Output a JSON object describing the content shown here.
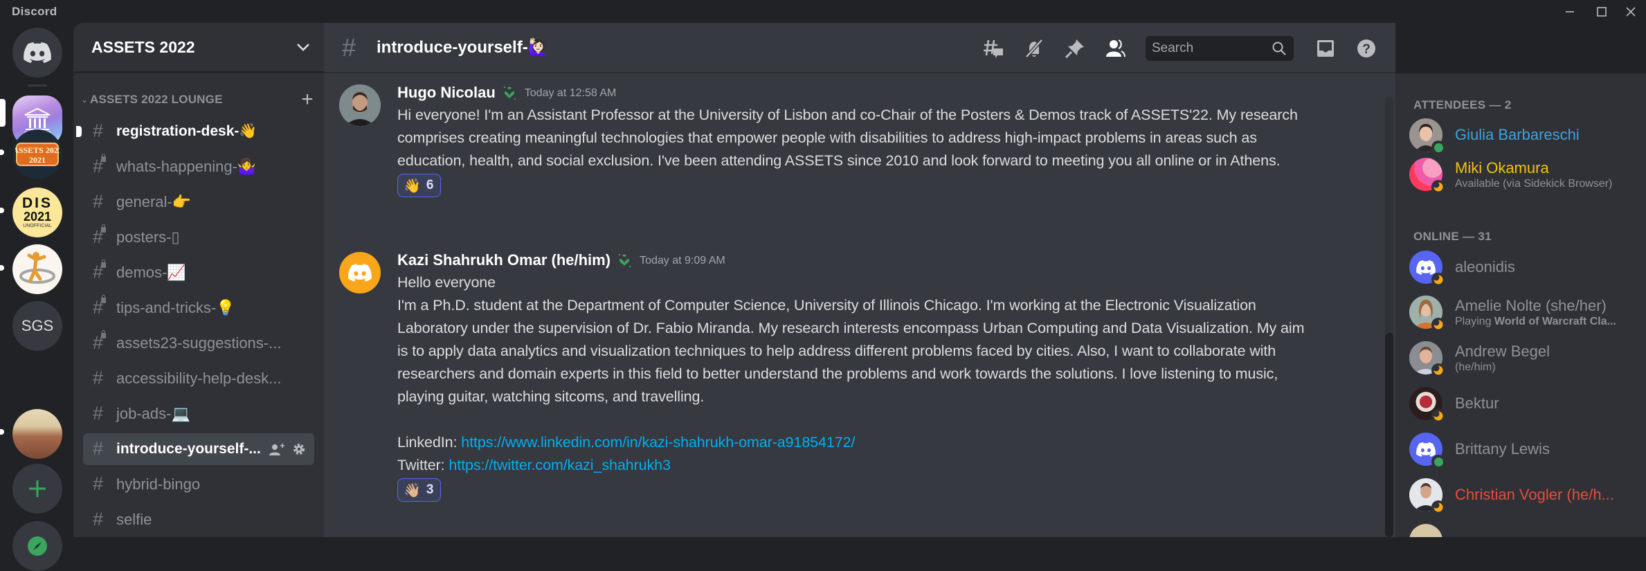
{
  "window": {
    "app_title": "Discord",
    "controls": [
      "minimize",
      "maximize",
      "close"
    ]
  },
  "server_rail": {
    "home_icon": "discord-logo-icon",
    "servers": [
      {
        "name": "ASSETS 2022",
        "icon": "assets-2022-server-icon",
        "active": true
      },
      {
        "name": "ASSETS 2021",
        "icon": "assets-2021-server-icon",
        "label": "ASSETS 2021",
        "unread": true
      },
      {
        "name": "DIS 2021 Unofficial",
        "icon": "dis-2021-server-icon",
        "label_top": "DIS",
        "label_mid": "2021",
        "label_bottom": "UNOFFICIAL",
        "unread": true
      },
      {
        "name": "Person logo server",
        "icon": "person-ring-server-icon",
        "unread": true
      },
      {
        "name": "SGS",
        "icon": "sgs-server-icon",
        "label": "SGS"
      },
      {
        "name": "Landscape server",
        "icon": "landscape-server-icon",
        "unread": true
      }
    ],
    "add_server_icon": "plus-icon",
    "explore_icon": "compass-icon"
  },
  "channel_sidebar": {
    "guild_name": "ASSETS 2022",
    "category": "ASSETS 2022 LOUNGE",
    "channels": [
      {
        "name": "registration-desk-👋",
        "locked": false,
        "unread": true
      },
      {
        "name": "whats-happening-🤷‍♀️",
        "locked": true
      },
      {
        "name": "general-👉",
        "locked": false
      },
      {
        "name": "posters-▯",
        "locked": true
      },
      {
        "name": "demos-📈",
        "locked": true
      },
      {
        "name": "tips-and-tricks-💡",
        "locked": true
      },
      {
        "name": "assets23-suggestions-...",
        "locked": true
      },
      {
        "name": "accessibility-help-desk...",
        "locked": false
      },
      {
        "name": "job-ads-💻",
        "locked": false
      },
      {
        "name": "introduce-yourself-...",
        "locked": false,
        "active": true
      },
      {
        "name": "hybrid-bingo",
        "locked": false
      },
      {
        "name": "selfie",
        "locked": false
      }
    ]
  },
  "chat": {
    "channel_title": "introduce-yourself-🙋🏻‍♀️",
    "header_icons": [
      "threads-icon",
      "mute-bell-icon",
      "pin-icon",
      "member-list-icon"
    ],
    "search_placeholder": "Search",
    "right_icons": [
      "inbox-icon",
      "help-icon"
    ],
    "messages": [
      {
        "author": "Hugo Nicolau",
        "timestamp": "Today at 12:58 AM",
        "paragraphs": [
          "Hi everyone! I'm an Assistant Professor at the University of Lisbon and co-Chair of the Posters & Demos track of ASSETS'22. My research comprises creating meaningful technologies that empower people with disabilities to address high-impact problems in areas such as education, health, and social exclusion. I've been attending ASSETS since 2010 and look forward to meeting you all online or in Athens."
        ],
        "reaction": {
          "emoji": "👋",
          "count": "6"
        }
      },
      {
        "author": "Kazi Shahrukh Omar (he/him)",
        "timestamp": "Today at 9:09 AM",
        "greeting": "Hello everyone",
        "body": "I'm a Ph.D. student at the Department of Computer Science, University of Illinois Chicago. I'm working at the Electronic Visualization Laboratory under the supervision of Dr. Fabio Miranda. My research interests encompass Urban Computing and Data Visualization. My aim is to apply data analytics and visualization techniques to help address different problems faced by cities. Also, I want to collaborate with researchers and domain experts in this field to better understand the problems and work towards the solutions. I love listening to music, playing guitar, watching sitcoms, and travelling.",
        "linkedin_label": "LinkedIn:",
        "linkedin_url": "https://www.linkedin.com/in/kazi-shahrukh-omar-a91854172/",
        "twitter_label": "Twitter:",
        "twitter_url": "https://twitter.com/kazi_shahrukh3",
        "reaction": {
          "emoji": "👋🏼",
          "count": "3"
        }
      }
    ]
  },
  "members": {
    "groups": [
      {
        "title": "ATTENDEES — 2",
        "items": [
          {
            "name": "Giulia Barbareschi",
            "color": "#3ea3dc",
            "status": "online"
          },
          {
            "name": "Miki Okamura",
            "color": "#f1c40f",
            "status": "idle",
            "sub": "Available (via Sidekick Browser)"
          }
        ]
      },
      {
        "title": "ONLINE — 31",
        "items": [
          {
            "name": "aleonidis",
            "color": "#8e9297",
            "status": "idle"
          },
          {
            "name": "Amelie Nolte (she/her)",
            "color": "#8e9297",
            "status": "idle",
            "sub_prefix": "Playing ",
            "sub_bold": "World of Warcraft Cla..."
          },
          {
            "name": "Andrew Begel",
            "color": "#8e9297",
            "status": "idle",
            "sub": "(he/him)"
          },
          {
            "name": "Bektur",
            "color": "#8e9297",
            "status": "idle"
          },
          {
            "name": "Brittany Lewis",
            "color": "#8e9297",
            "status": "online"
          },
          {
            "name": "Christian Vogler (he/h...",
            "color": "#e74c3c",
            "status": "idle"
          }
        ]
      }
    ]
  },
  "colors": {
    "accent": "#5865f2",
    "online": "#3ba55d",
    "idle": "#faa81a",
    "link": "#00aff4"
  }
}
